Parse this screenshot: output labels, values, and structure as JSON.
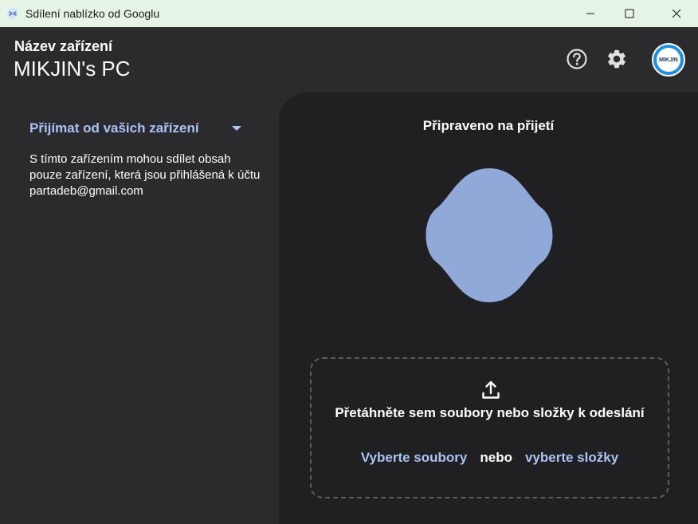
{
  "window": {
    "title": "Sdílení nablízko od Googlu",
    "app_icon": "nearby-share-icon",
    "controls": [
      "minimize-icon",
      "maximize-icon",
      "close-icon"
    ]
  },
  "header": {
    "device_label": "Název zařízení",
    "device_name": "MIKJIN's PC",
    "icons": [
      "help-icon",
      "gear-icon"
    ],
    "avatar_text": "MIKJIN"
  },
  "left_panel": {
    "receive_option": "Přijímat od vašich zařízení",
    "description": "S tímto zařízením mohou sdílet obsah pouze zařízení, která jsou přihlášená k účtu partadeb@gmail.com"
  },
  "right_panel": {
    "status": "Připraveno na přijetí",
    "drop_text": "Přetáhněte sem soubory nebo složky k odeslání",
    "select_files": "Vyberte soubory",
    "or": "nebo",
    "select_folders": "vyberte složky"
  },
  "colors": {
    "accent": "#a8c4f5",
    "blob": "#90a9d8",
    "titlebar": "#e6f4e6",
    "panel_left": "#2b2b2e",
    "panel_right": "#202022"
  }
}
